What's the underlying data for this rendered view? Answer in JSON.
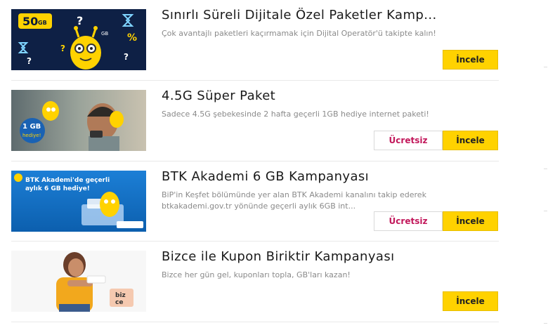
{
  "cards": [
    {
      "title": "Sınırlı Süreli Dijitale Özel Paketler Kamp...",
      "desc": "Çok avantajlı paketleri kaçırmamak için Dijital Operatör'ü takipte kalın!",
      "inspect_label": "İncele",
      "thumb": {
        "badge": "50GB",
        "colors": {
          "bg": "#0b1a3a",
          "accent": "#ffd200"
        }
      }
    },
    {
      "title": "4.5G Süper Paket",
      "desc": "Sadece 4.5G şebekesinde 2 hafta geçerli 1GB hediye internet paketi!",
      "free_label": "Ücretsiz",
      "inspect_label": "İncele",
      "thumb": {
        "badge": "1 GB hediye!"
      }
    },
    {
      "title": "BTK Akademi 6 GB Kampanyası",
      "desc": "BiP'in Keşfet bölümünde yer alan BTK Akademi kanalını takip ederek btkakademi.gov.tr yönünde geçerli aylık 6GB int...",
      "free_label": "Ücretsiz",
      "inspect_label": "İncele",
      "thumb": {
        "line1": "BTK Akademi'de geçerli",
        "line2": "aylık 6 GB hediye!"
      }
    },
    {
      "title": "Bizce ile Kupon Biriktir Kampanyası",
      "desc": "Bizce her gün gel, kuponları topla, GB'ları kazan!",
      "inspect_label": "İncele",
      "thumb": {
        "logo": "biz ce"
      }
    }
  ],
  "colors": {
    "yellow": "#ffd200",
    "magenta": "#c2185b",
    "muted": "#8a8a8a"
  }
}
